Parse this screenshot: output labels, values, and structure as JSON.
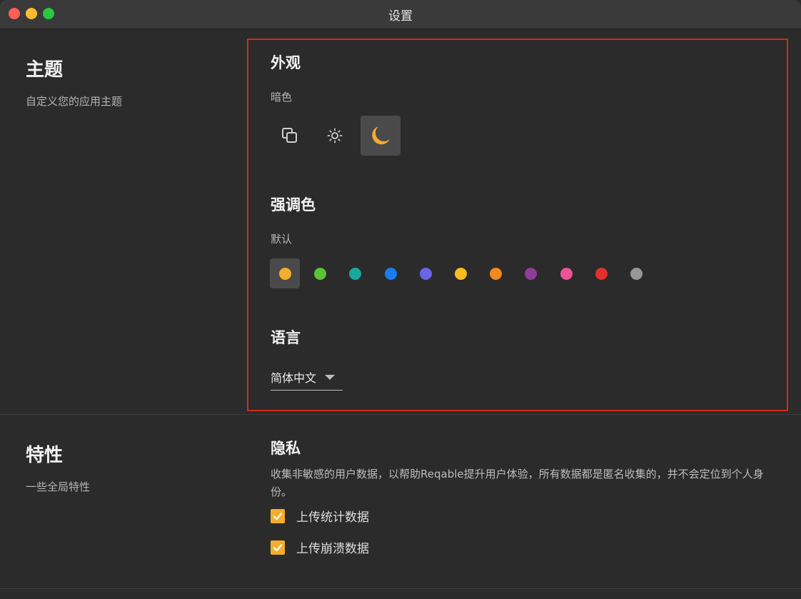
{
  "window": {
    "title": "设置"
  },
  "theme_section": {
    "title": "主题",
    "subtitle": "自定义您的应用主题",
    "appearance": {
      "heading": "外观",
      "current_mode": "暗色",
      "modes": [
        {
          "icon": "system-mode-icon",
          "selected": false
        },
        {
          "icon": "sun-icon",
          "selected": false
        },
        {
          "icon": "moon-icon",
          "selected": true
        }
      ]
    },
    "accent": {
      "heading": "强调色",
      "current": "默认",
      "colors": [
        "#f4ad2f",
        "#5bc236",
        "#1aa89a",
        "#1a7cf0",
        "#6a64e6",
        "#f7bd1c",
        "#f2891f",
        "#8e3d99",
        "#f0529a",
        "#e2312f",
        "#979797"
      ],
      "selected_index": 0
    },
    "language": {
      "heading": "语言",
      "value": "简体中文"
    }
  },
  "features_section": {
    "title": "特性",
    "subtitle": "一些全局特性",
    "privacy": {
      "heading": "隐私",
      "description": "收集非敏感的用户数据，以帮助Reqable提升用户体验，所有数据都是匿名收集的，并不会定位到个人身份。",
      "options": [
        {
          "label": "上传统计数据",
          "checked": true
        },
        {
          "label": "上传崩溃数据",
          "checked": true
        }
      ]
    }
  },
  "colors": {
    "accent": "#f4ad2f",
    "highlight_border": "#d8281c"
  }
}
